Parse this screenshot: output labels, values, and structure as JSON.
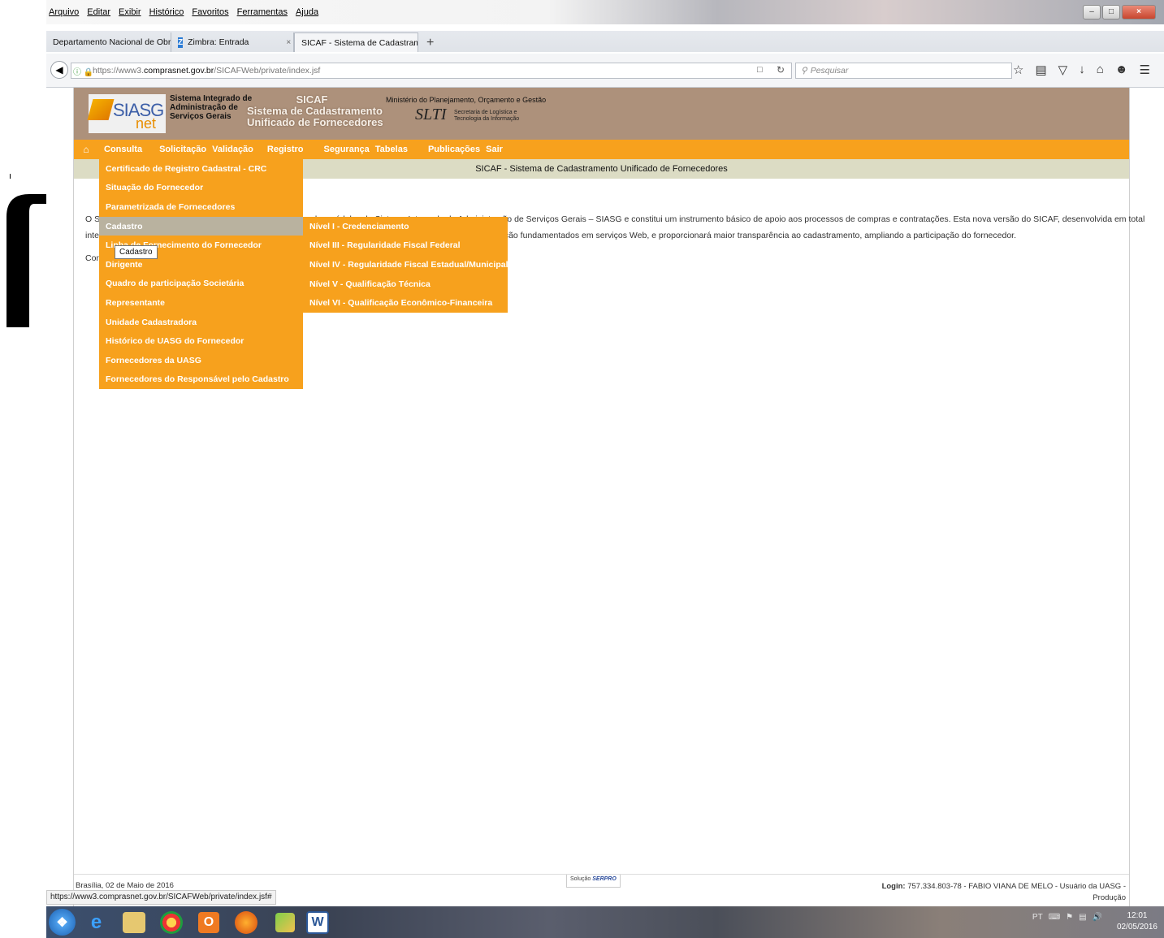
{
  "browser": {
    "menu": [
      "Arquivo",
      "Editar",
      "Exibir",
      "Histórico",
      "Favoritos",
      "Ferramentas",
      "Ajuda"
    ],
    "tabs": [
      {
        "label": "Departamento Nacional de Obr...",
        "close": "×"
      },
      {
        "label": "Zimbra: Entrada",
        "close": "×"
      },
      {
        "label": "SICAF - Sistema de Cadastrame...",
        "close": "×"
      }
    ],
    "url_prefix": "https://www3.",
    "url_domain": "comprasnet.gov.br",
    "url_path": "/SICAFWeb/private/index.jsf",
    "search_placeholder": "Pesquisar",
    "status_url": "https://www3.comprasnet.gov.br/SICAFWeb/private/index.jsf#"
  },
  "banner": {
    "logo_siasg": "SIASG",
    "logo_net": "net",
    "siasg_full": "Sistema Integrado de\nAdministração de\nServiços Gerais",
    "sicaf_title": "SICAF\nSistema de Cadastramento\nUnificado de Fornecedores",
    "ministerio": "Ministério do Planejamento, Orçamento e Gestão",
    "slti": "SLTI",
    "slti_sub": "Secretaria de Logística e\nTecnologia da Informação"
  },
  "main_menu": [
    "Consulta",
    "Solicitação",
    "Validação",
    "Registro",
    "Segurança",
    "Tabelas",
    "Publicações",
    "Sair"
  ],
  "page_title": "SICAF - Sistema de Cadastramento Unificado de Fornecedores",
  "content": {
    "p1_left_a": "O Si",
    "p1_left_b": "inter",
    "p1_right_a": "É um dos módulos do Sistema Integrado de Administração de Serviços Gerais – SIASG e constitui um instrumento básico de apoio aos processos de compras e contratações. Esta nova versão do SICAF, desenvolvida em total",
    "p1_right_b": "ação fundamentados em serviços Web, e proporcionará maior transparência ao cadastramento, ampliando a participação do fornecedor.",
    "p2": "Con"
  },
  "consulta_dropdown": [
    "Certificado de Registro Cadastral - CRC",
    "Situação do Fornecedor",
    "Parametrizada de Fornecedores",
    "Cadastro",
    "Linha de Fornecimento do Fornecedor",
    "Dirigente",
    "Quadro de participação Societária",
    "Representante",
    "Unidade Cadastradora",
    "Histórico de UASG do Fornecedor",
    "Fornecedores da UASG",
    "Fornecedores do Responsável pelo Cadastro"
  ],
  "cadastro_submenu": [
    "Nível I - Credenciamento",
    "Nível III - Regularidade Fiscal Federal",
    "Nível IV - Regularidade Fiscal Estadual/Municipal",
    "Nível V - Qualificação Técnica",
    "Nível VI - Qualificação Econômico-Financeira"
  ],
  "tooltip": "Cadastro",
  "footer": {
    "date": "Brasília, 02 de Maio de 2016",
    "serpro_prefix": "Solução",
    "serpro": "SERPRO",
    "login_label": "Login:",
    "login_value": "757.334.803-78 - FABIO VIANA DE MELO - Usuário da UASG -",
    "login_env": "Produção"
  },
  "taskbar": {
    "tray_lang": "PT",
    "time": "12:01",
    "date": "02/05/2016"
  },
  "colors": {
    "menu_orange": "#f7a11d",
    "banner_brown": "#ad917b",
    "title_bar": "#dcdcc4",
    "active_item": "#b9b29f"
  }
}
